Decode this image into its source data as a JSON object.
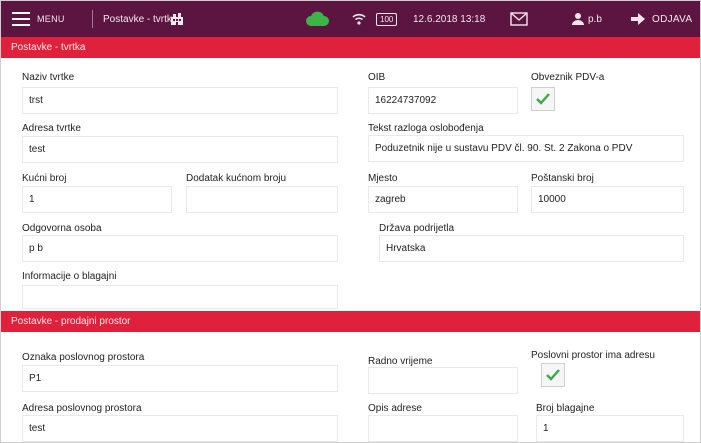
{
  "topbar": {
    "menu_label": "MENU",
    "page_title": "Postavke - tvrtka",
    "battery_label": "100",
    "datetime": "12.6.2018 13:18",
    "user_name": "p.b",
    "logout_label": "ODJAVA",
    "icons": [
      "menu-icon",
      "building-icon",
      "cloud-icon",
      "wifi-icon",
      "battery-icon",
      "mail-icon",
      "user-icon",
      "arrow-right-icon"
    ],
    "colors": {
      "bar": "#5b1540",
      "cloud": "#3db34a"
    }
  },
  "company_section": {
    "title": "Postavke - tvrtka",
    "naziv_label": "Naziv tvrtke",
    "naziv_value": "trst",
    "oib_label": "OIB",
    "oib_value": "16224737092",
    "pdv_label": "Obveznik PDV-a",
    "pdv_checked": true,
    "adresa_label": "Adresa tvrtke",
    "adresa_value": "test",
    "razlog_label": "Tekst razloga oslobođenja",
    "razlog_value": "Poduzetnik nije u sustavu PDV čl. 90. St. 2 Zakona o PDV",
    "kucni_label": "Kućni broj",
    "kucni_value": "1",
    "dodatak_label": "Dodatak kućnom broju",
    "dodatak_value": "",
    "mjesto_label": "Mjesto",
    "mjesto_value": "zagreb",
    "postanski_label": "Poštanski broj",
    "postanski_value": "10000",
    "osoba_label": "Odgovorna osoba",
    "osoba_value": "p b",
    "drzava_label": "Država podrijetla",
    "drzava_value": "Hrvatska",
    "info_label": "Informacije o blagajni",
    "info_value": ""
  },
  "premises_section": {
    "title": "Postavke - prodajni prostor",
    "oznaka_label": "Oznaka poslovnog prostora",
    "oznaka_value": "P1",
    "radno_label": "Radno vrijeme",
    "radno_value": "",
    "ima_adresu_label": "Poslovni prostor ima adresu",
    "ima_adresu_checked": true,
    "adresa_label": "Adresa poslovnog prostora",
    "adresa_value": "test",
    "opis_label": "Opis adrese",
    "opis_value": "",
    "blagajna_label": "Broj blagajne",
    "blagajna_value": "1"
  },
  "colors": {
    "section_header": "#e0213b",
    "check": "#3aa84a"
  }
}
